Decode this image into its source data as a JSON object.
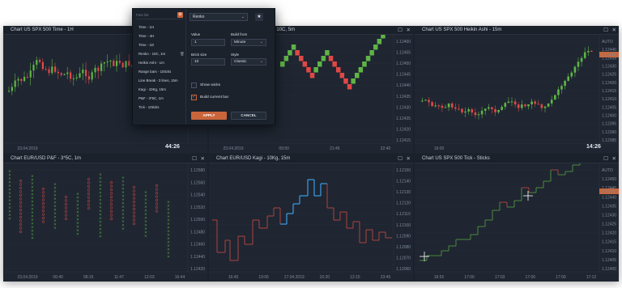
{
  "panels": [
    {
      "title": "Chart US SPX 500 Time - 1H",
      "yticks": [],
      "xticks": [
        "23.04.2019"
      ],
      "clock": "44:26"
    },
    {
      "title": "Chart US SPX 500 Renko - 10C, 5m",
      "yticks": [
        "1.12460",
        "1.12455",
        "1.12450",
        "1.12445",
        "1.12440",
        "1.12435",
        "1.12430",
        "1.12425",
        "1.12420",
        "1.12415"
      ],
      "xticks": [
        "23.04.2019",
        "09:50",
        "21:45",
        "22:40"
      ],
      "clock": ""
    },
    {
      "title": "Chart US SPX 500 Heikin Ashi - 15m",
      "yticks": [
        "AUTO",
        "1.12440",
        "1.12435",
        "1.12430",
        "1.12425",
        "1.12420",
        "1.12415",
        "1.12410",
        "1.12405",
        "1.12400",
        "1.12395",
        "1.12390",
        "1.12385"
      ],
      "xticks": [
        "16:00"
      ],
      "price_tag": "1.12434",
      "clock": "14:26"
    },
    {
      "title": "Chart EUR/USD P&F - 3*5C, 1m",
      "yticks": [
        "1.12580",
        "1.12560",
        "1.12540",
        "1.12520",
        "1.12500",
        "1.12480",
        "1.12460",
        "1.12440",
        "1.12420"
      ],
      "xticks": [
        "23.04.2019",
        "06:40",
        "08:15",
        "11:47",
        "12:03",
        "16:44"
      ],
      "clock": ""
    },
    {
      "title": "Chart EUR/USD Kagi - 10Kg, 15m",
      "yticks": [
        "1.12150",
        "1.12140",
        "1.12130",
        "1.12120",
        "1.12110",
        "1.12100",
        "1.12090",
        "1.12080",
        "1.12070",
        "1.12060"
      ],
      "xticks": [
        "16:45",
        "19:05",
        "17.04.2019",
        "10:20",
        "12:15",
        "23:45"
      ],
      "clock": ""
    },
    {
      "title": "Chart US SPX 500 Tick - Sticks",
      "yticks": [
        "AUTO",
        "1.12450",
        "1.12445",
        "1.12440",
        "1.12435",
        "1.12430",
        "1.12425",
        "1.12420",
        "1.12415",
        "1.12410",
        "1.12405",
        "1.12400"
      ],
      "xticks": [
        "16:55",
        "17:00",
        "17:03",
        "17:06",
        "17:09",
        "17:12"
      ],
      "price_tag": "2.913.0",
      "clock": ""
    }
  ],
  "popup": {
    "filter_placeholder": "Fast list",
    "list_items": [
      "Time - 1H",
      "Time - 4H",
      "Time - 1D",
      "Renko - 10C, 1m",
      "Heikin Ashi - 1m",
      "Range bars - 10ticks",
      "Line Break - 3 lines, 15m",
      "Kagi - 10Kg, 15m",
      "P&F - 3*5C, 1m",
      "Tick - 10ticks"
    ],
    "chart_type": "Renko",
    "value_label": "Value",
    "value": "1",
    "build_from_label": "Build from",
    "build_from": "Minute",
    "brick_size_label": "Brick size",
    "brick_size": "10",
    "style_label": "Style",
    "style": "Classic",
    "show_wicks_label": "Show wicks",
    "build_current_bar_label": "Build current bar",
    "apply_label": "APPLY",
    "cancel_label": "CANCEL"
  },
  "colors": {
    "up": "#5fb446",
    "down": "#e04848",
    "accent": "#c9653b",
    "kagi_up": "#3a9de6",
    "kagi_down": "#d04a45",
    "tick_label": "#7f8a99"
  }
}
